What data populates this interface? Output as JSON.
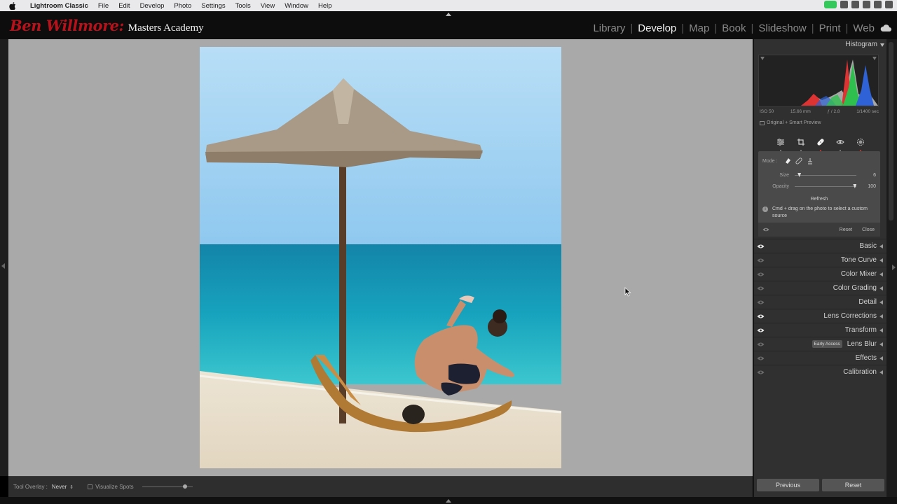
{
  "menubar": {
    "items": [
      "Lightroom Classic",
      "File",
      "Edit",
      "Develop",
      "Photo",
      "Settings",
      "Tools",
      "View",
      "Window",
      "Help"
    ]
  },
  "identity_plate": {
    "script_text": "Ben Willmore:",
    "text": "Masters Academy"
  },
  "modules": {
    "items": [
      "Library",
      "Develop",
      "Map",
      "Book",
      "Slideshow",
      "Print",
      "Web"
    ],
    "active": "Develop"
  },
  "toolbar": {
    "tool_overlay_label": "Tool Overlay :",
    "tool_overlay_value": "Never",
    "visualize_spots_label": "Visualize Spots",
    "visualize_spots_checked": false,
    "visualize_threshold": 0.85
  },
  "histogram": {
    "title": "Histogram",
    "exif": {
      "iso": "ISO 50",
      "focal": "15.66 mm",
      "aperture": "ƒ / 2.8",
      "shutter": "1/1400 sec"
    },
    "preview_label": "Original + Smart Preview"
  },
  "heal_panel": {
    "mode_label": "Mode :",
    "size_label": "Size",
    "size_value": "6",
    "size_fraction": 0.07,
    "opacity_label": "Opacity",
    "opacity_value": "100",
    "opacity_fraction": 0.97,
    "refresh_label": "Refresh",
    "info_text": "Cmd + drag on the photo to select a custom source",
    "reset_label": "Reset",
    "close_label": "Close"
  },
  "panels": [
    {
      "name": "Basic",
      "eye_on": true
    },
    {
      "name": "Tone Curve",
      "eye_on": false
    },
    {
      "name": "Color Mixer",
      "eye_on": false
    },
    {
      "name": "Color Grading",
      "eye_on": false
    },
    {
      "name": "Detail",
      "eye_on": false
    },
    {
      "name": "Lens Corrections",
      "eye_on": true
    },
    {
      "name": "Transform",
      "eye_on": true
    },
    {
      "name": "Lens Blur",
      "eye_on": false,
      "badge": "Early Access"
    },
    {
      "name": "Effects",
      "eye_on": false
    },
    {
      "name": "Calibration",
      "eye_on": false
    }
  ],
  "bottom_buttons": {
    "previous": "Previous",
    "reset": "Reset"
  },
  "colors": {
    "identity_red": "#b5121b",
    "canvas_gray": "#a9a9a9",
    "panel_bg": "#303030",
    "sky_top": "#b4dcf6",
    "sea": "#1aa6c0"
  }
}
